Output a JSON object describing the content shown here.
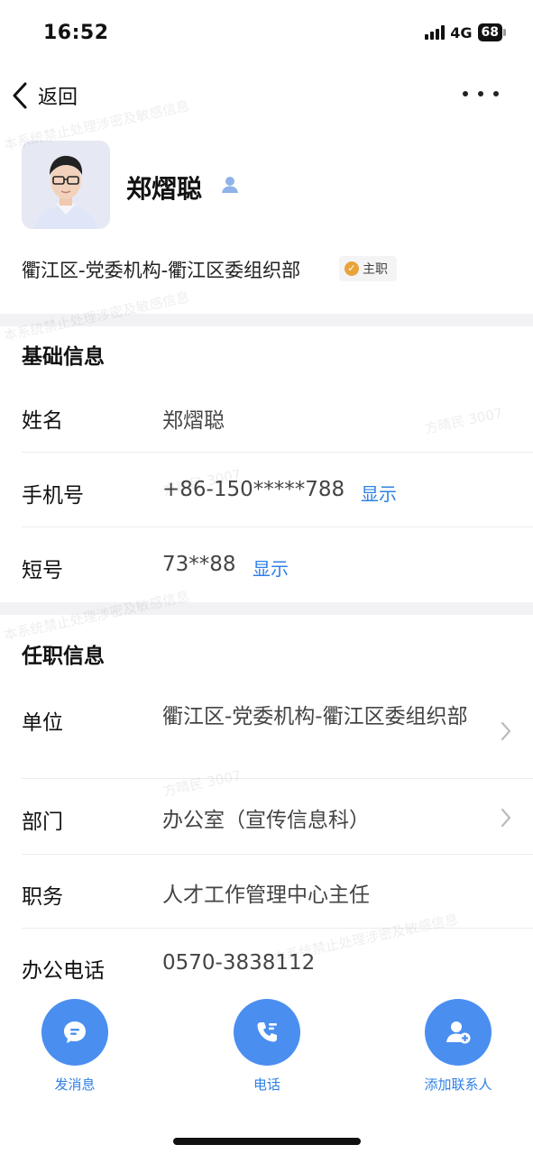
{
  "status_bar": {
    "time": "16:52",
    "network": "4G",
    "battery": "68"
  },
  "nav": {
    "back_label": "返回"
  },
  "profile": {
    "name": "郑熠聪",
    "org_path": "衢江区-党委机构-衢江区委组织部",
    "main_badge": "主职"
  },
  "basic_info": {
    "title": "基础信息",
    "name_label": "姓名",
    "name_value": "郑熠聪",
    "phone_label": "手机号",
    "phone_value": "+86-150*****788",
    "phone_show": "显示",
    "short_label": "短号",
    "short_value": "73**88",
    "short_show": "显示"
  },
  "job_info": {
    "title": "任职信息",
    "unit_label": "单位",
    "unit_value": "衢江区-党委机构-衢江区委组织部",
    "dept_label": "部门",
    "dept_value": "办公室（宣传信息科）",
    "position_label": "职务",
    "position_value": "人才工作管理中心主任",
    "office_phone_label": "办公电话",
    "office_phone_value": "0570-3838112"
  },
  "actions": {
    "message": "发消息",
    "call": "电话",
    "add_contact": "添加联系人"
  },
  "watermarks": [
    "本系统禁止处理涉密及敏感信息",
    "方晴民 3007"
  ],
  "colors": {
    "accent": "#4a8ef0",
    "link": "#2f80e6",
    "badge": "#e8a33c"
  },
  "icons": [
    "back-chevron-icon",
    "more-icon",
    "person-icon",
    "verified-badge-icon",
    "chevron-right-icon",
    "message-icon",
    "phone-icon",
    "add-contact-icon"
  ]
}
